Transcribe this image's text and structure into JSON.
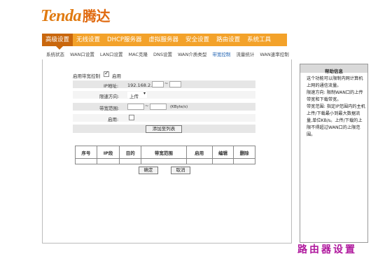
{
  "brand": {
    "logo_latin": "Tenda",
    "logo_cn": "腾达"
  },
  "main_nav": [
    "高级设置",
    "无线设置",
    "DHCP服务器",
    "虚拟服务器",
    "安全设置",
    "路由设置",
    "系统工具"
  ],
  "sub_nav": [
    "系统状态",
    "WAN口设置",
    "LAN口设置",
    "MAC克隆",
    "DNS设置",
    "WAN介质类型",
    "带宽控制",
    "流量统计",
    "WAN速率控制"
  ],
  "form": {
    "enable_bw_label": "启用带宽控制",
    "enable_label": "启用",
    "ip_label": "IP地址:",
    "ip_prefix": "192.168.2.",
    "ip_sep": "~",
    "direction_label": "限速方向:",
    "direction_value": "上传",
    "range_label": "带宽范围:",
    "range_sep": "~",
    "range_unit": "(KByte/s)",
    "enabled_label": "启用:",
    "add_button": "添加至列表"
  },
  "table": {
    "headers": [
      "序号",
      "IP段",
      "目的",
      "带宽范围",
      "启用",
      "编辑",
      "删除"
    ]
  },
  "buttons": {
    "ok": "确定",
    "cancel": "取消"
  },
  "help": {
    "title": "帮助信息",
    "body": "这个功能可以限制内网计算机上网的通信流量。\n限速方向: 限制WAN口的上传带宽和下载带宽。\n带宽范围: 指定IP范围内的主机上传/下载最小到最大数据流量,单位KB/s。上传/下载的上限不得超过WAN口的上限范围。"
  },
  "watermark": "路由器设置"
}
